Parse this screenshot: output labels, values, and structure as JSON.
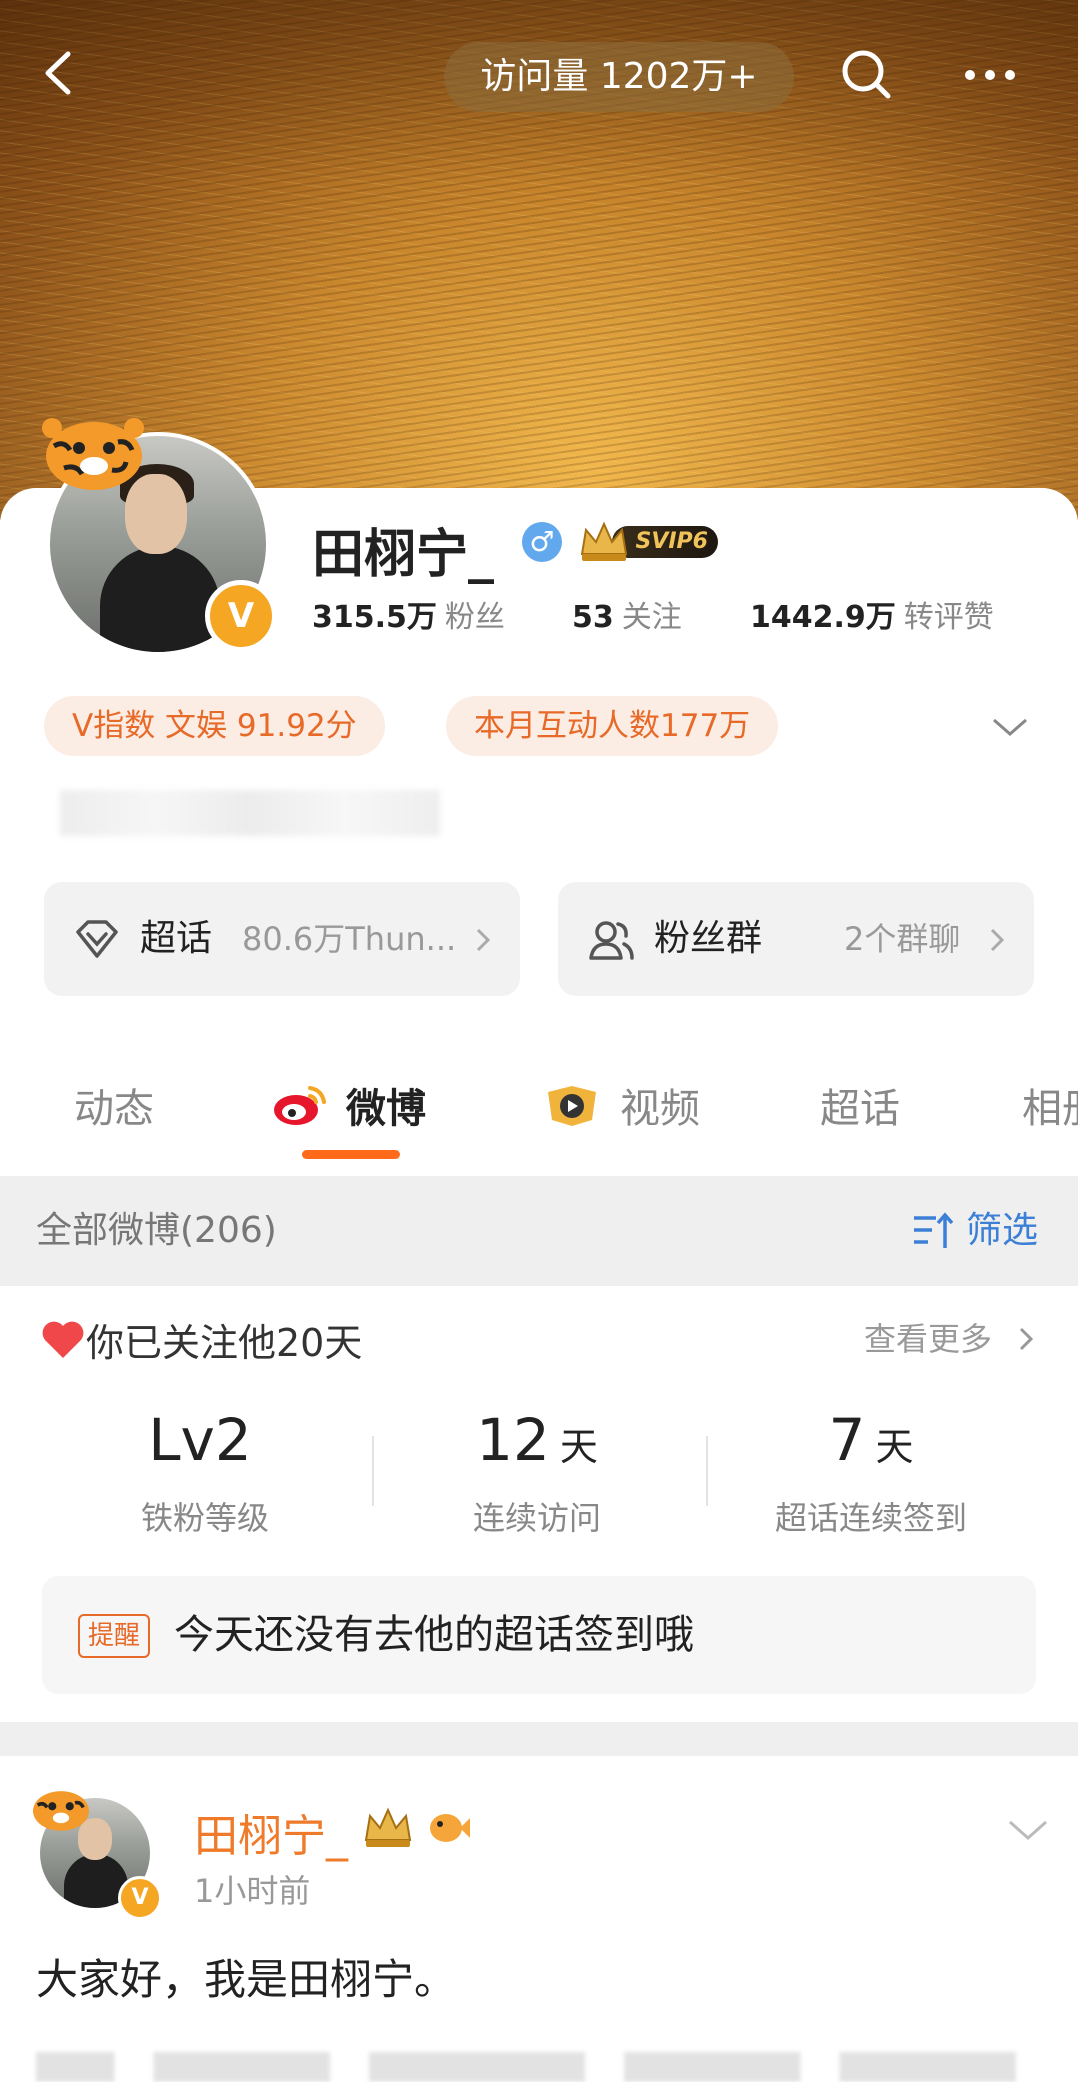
{
  "topbar": {
    "visits": "访问量 1202万+"
  },
  "profile": {
    "name": "田栩宁_",
    "gender_symbol": "♂",
    "svip_label": "SVIP6",
    "verify_mark": "V",
    "stats": [
      {
        "value": "315.5万",
        "label": "粉丝"
      },
      {
        "value": "53",
        "label": "关注"
      },
      {
        "value": "1442.9万",
        "label": "转评赞"
      }
    ],
    "chips": [
      "V指数 文娱 91.92分",
      "本月互动人数177万"
    ]
  },
  "entries": {
    "topic": {
      "title": "超话",
      "sub": "80.6万Thun..."
    },
    "fans": {
      "title": "粉丝群",
      "sub": "2个群聊"
    }
  },
  "tabs": [
    "动态",
    "微博",
    "视频",
    "超话",
    "相册"
  ],
  "filterbar": {
    "count": "全部微博(206)",
    "filter": "筛选"
  },
  "fan_card": {
    "title": "你已关注他20天",
    "see_more": "查看更多",
    "metrics": [
      {
        "value": "Lv2",
        "unit": "",
        "label": "铁粉等级"
      },
      {
        "value": "12",
        "unit": "天",
        "label": "连续访问"
      },
      {
        "value": "7",
        "unit": "天",
        "label": "超话连续签到"
      }
    ],
    "reminder_tag": "提醒",
    "reminder_text": "今天还没有去他的超话签到哦"
  },
  "post": {
    "author": "田栩宁_",
    "time": "1小时前",
    "text": "大家好，我是田栩宁。",
    "verify_mark": "V"
  },
  "colors": {
    "accent": "#ff6a1a",
    "link": "#3c7fd6",
    "chip_text": "#e76a28",
    "verify": "#f5a623"
  }
}
